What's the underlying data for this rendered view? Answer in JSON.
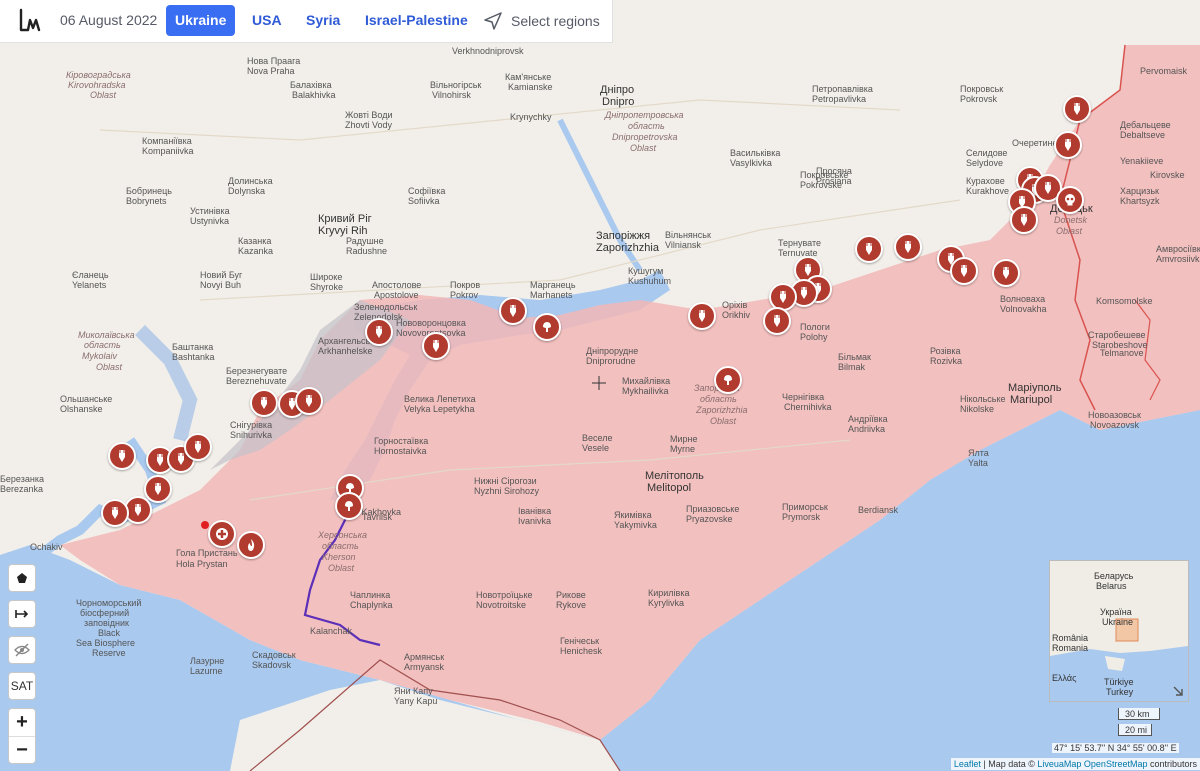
{
  "header": {
    "date": "06 August 2022",
    "tabs": [
      {
        "label": "Ukraine",
        "active": true
      },
      {
        "label": "USA",
        "active": false
      },
      {
        "label": "Syria",
        "active": false
      },
      {
        "label": "Israel-Palestine",
        "active": false
      }
    ],
    "select_regions": "Select regions"
  },
  "colors": {
    "occupied_fill": "#f2b7b7",
    "land": "#f2efea",
    "water": "#a9c9ef",
    "marker": "#b13b2e",
    "front_line": "#d9534f",
    "tab_active": "#3a6ef2",
    "route_line": "#5b2fb8"
  },
  "map": {
    "labels": [
      {
        "id": "verkhnodniprovsk",
        "text": "Verkhnodniprovsk"
      },
      {
        "id": "kirovohradska",
        "text": "Кіровоградська"
      },
      {
        "id": "kirovohradska_lat",
        "text": "Kirovohradska"
      },
      {
        "id": "kirovohradska_oblast",
        "text": "Oblast"
      },
      {
        "id": "nova_prarha",
        "text": "Нова Праага"
      },
      {
        "id": "nova_prarha_lat",
        "text": "Nova Praha"
      },
      {
        "id": "kamianske",
        "text": "Кам'янське"
      },
      {
        "id": "kamianske_lat",
        "text": "Kamianske"
      },
      {
        "id": "dnipro",
        "text": "Дніпро"
      },
      {
        "id": "dnipro_lat",
        "text": "Dnipro"
      },
      {
        "id": "dnipropetrovska",
        "text": "Дніпропетровська"
      },
      {
        "id": "dnipropetrovska2",
        "text": "область"
      },
      {
        "id": "dnipropetrovska3",
        "text": "Dnipropetrovska"
      },
      {
        "id": "dnipropetrovska4",
        "text": "Oblast"
      },
      {
        "id": "balakhivka",
        "text": "Балахівка"
      },
      {
        "id": "balakhivka_lat",
        "text": "Balakhivka"
      },
      {
        "id": "vilnohirsk",
        "text": "Вільногірськ"
      },
      {
        "id": "vilnohirsk_lat",
        "text": "Vilnohirsk"
      },
      {
        "id": "zhovti_vody",
        "text": "Жовті Води"
      },
      {
        "id": "zhovti_vody_lat",
        "text": "Zhovti Vody"
      },
      {
        "id": "kryvyi_rih",
        "text": "Кривий Ріг"
      },
      {
        "id": "kryvyi_rih_lat",
        "text": "Kryvyi Rih"
      },
      {
        "id": "zaporizhzhia",
        "text": "Запоріжжя"
      },
      {
        "id": "zaporizhzhia_lat",
        "text": "Zaporizhzhia"
      },
      {
        "id": "zaporizka",
        "text": "Запорізька"
      },
      {
        "id": "zaporizka2",
        "text": "область"
      },
      {
        "id": "zaporizka3",
        "text": "Zaporizhzhia"
      },
      {
        "id": "zaporizka4",
        "text": "Oblast"
      },
      {
        "id": "donetsk",
        "text": "Донецьк"
      },
      {
        "id": "donetsk_lat",
        "text": "Donetsk"
      },
      {
        "id": "donetska",
        "text": "Oblast"
      },
      {
        "id": "mariupol",
        "text": "Маріуполь"
      },
      {
        "id": "mariupol_lat",
        "text": "Mariupol"
      },
      {
        "id": "melitopol",
        "text": "Мелітополь"
      },
      {
        "id": "melitopol_lat",
        "text": "Melitopol"
      },
      {
        "id": "berdiansk",
        "text": "Berdiansk"
      },
      {
        "id": "kherson_obl",
        "text": "Херсонська"
      },
      {
        "id": "kherson_obl2",
        "text": "область"
      },
      {
        "id": "kherson_obl3",
        "text": "Kherson"
      },
      {
        "id": "kherson_obl4",
        "text": "Oblast"
      },
      {
        "id": "mykolaiv",
        "text": "Миколаївська"
      },
      {
        "id": "mykolaiv2",
        "text": "область"
      },
      {
        "id": "mykolaiv3",
        "text": "Mykolaiv"
      },
      {
        "id": "mykolaiv4",
        "text": "Oblast"
      },
      {
        "id": "nova_kakhovka",
        "text": "Nova Kakhovka"
      },
      {
        "id": "hola_prystan",
        "text": "Гола Пристань"
      },
      {
        "id": "hola_prystan_lat",
        "text": "Hola Prystan"
      },
      {
        "id": "skadovsk",
        "text": "Скадовськ"
      },
      {
        "id": "skadovsk_lat",
        "text": "Skadovsk"
      },
      {
        "id": "lazurne",
        "text": "Лазурне"
      },
      {
        "id": "lazurne_lat",
        "text": "Lazurne"
      },
      {
        "id": "kalanchak",
        "text": "Kalanchak"
      },
      {
        "id": "armyansk",
        "text": "Армянськ"
      },
      {
        "id": "armyansk_lat",
        "text": "Armyansk"
      },
      {
        "id": "yany_kapu",
        "text": "Яни Капу"
      },
      {
        "id": "yany_kapu_lat",
        "text": "Yany Kapu"
      },
      {
        "id": "chaplynka",
        "text": "Чаплинка"
      },
      {
        "id": "chaplynka_lat",
        "text": "Chaplynka"
      },
      {
        "id": "henichesk",
        "text": "Генічеськ"
      },
      {
        "id": "henichesk_lat",
        "text": "Henichesk"
      },
      {
        "id": "novotroitske",
        "text": "Новотроїцьке"
      },
      {
        "id": "novotroitske_lat",
        "text": "Novotroitske"
      },
      {
        "id": "rykove",
        "text": "Рикове"
      },
      {
        "id": "rykove_lat",
        "text": "Rykove"
      },
      {
        "id": "nyzhni_sirohozy",
        "text": "Нижні Сірогози"
      },
      {
        "id": "nyzhni_sirohozy_lat",
        "text": "Nyzhni Sirohozy"
      },
      {
        "id": "velyka_lepetykha",
        "text": "Велика Лепетиха"
      },
      {
        "id": "velyka_lepetykha_lat",
        "text": "Velyka Lepetykha"
      },
      {
        "id": "hornostaivka",
        "text": "Горностаївка"
      },
      {
        "id": "hornostaivka_lat",
        "text": "Hornostaivka"
      },
      {
        "id": "vesele",
        "text": "Веселе"
      },
      {
        "id": "vesele_lat",
        "text": "Vesele"
      },
      {
        "id": "myrne",
        "text": "Мирне"
      },
      {
        "id": "myrne_lat",
        "text": "Myrne"
      },
      {
        "id": "ivanivka",
        "text": "Іванівка"
      },
      {
        "id": "ivanivka_lat",
        "text": "Ivanivka"
      },
      {
        "id": "yakymivka",
        "text": "Якимівка"
      },
      {
        "id": "yakymivka_lat",
        "text": "Yakymivka"
      },
      {
        "id": "pryazovske",
        "text": "Приазовське"
      },
      {
        "id": "pryazovske_lat",
        "text": "Pryazovske"
      },
      {
        "id": "prymorsk",
        "text": "Приморськ"
      },
      {
        "id": "prymorsk_lat",
        "text": "Prymorsk"
      },
      {
        "id": "kyrylivka",
        "text": "Кирилівка"
      },
      {
        "id": "kyrylivka_lat",
        "text": "Kyrylivka"
      },
      {
        "id": "chernihivka",
        "text": "Чернігівка"
      },
      {
        "id": "chernihivka_lat",
        "text": "Chernihivka"
      },
      {
        "id": "bilmak",
        "text": "Більмак"
      },
      {
        "id": "bilmak_lat",
        "text": "Bilmak"
      },
      {
        "id": "polohy",
        "text": "Пологи"
      },
      {
        "id": "polohy_lat",
        "text": "Polohy"
      },
      {
        "id": "orikhiv",
        "text": "Оріхів"
      },
      {
        "id": "orikhiv_lat",
        "text": "Orikhiv"
      },
      {
        "id": "mykhailivka",
        "text": "Михайлівка"
      },
      {
        "id": "mykhailivka_lat",
        "text": "Mykhailivka"
      },
      {
        "id": "dniprorudne",
        "text": "Дніпрорудне"
      },
      {
        "id": "dniprorudne_lat",
        "text": "Dniprorudne"
      },
      {
        "id": "marhanets",
        "text": "Марганець"
      },
      {
        "id": "marhanets_lat",
        "text": "Marhanets"
      },
      {
        "id": "pokrov",
        "text": "Покров"
      },
      {
        "id": "pokrov_lat",
        "text": "Pokrov"
      },
      {
        "id": "apostolove",
        "text": "Апостолове"
      },
      {
        "id": "apostolove_lat",
        "text": "Apostolove"
      },
      {
        "id": "zelenodolsk",
        "text": "Зеленодольськ"
      },
      {
        "id": "zelenodolsk_lat",
        "text": "Zelenodolsk"
      },
      {
        "id": "novovorontsovka",
        "text": "Нововоронцовка"
      },
      {
        "id": "novovorontsovka_lat",
        "text": "Novovorontsovka"
      },
      {
        "id": "arkhanhelske",
        "text": "Архангельське"
      },
      {
        "id": "arkhanhelske_lat",
        "text": "Arkhanhelske"
      },
      {
        "id": "bereznehuvate",
        "text": "Березнегувате"
      },
      {
        "id": "bereznehuvate_lat",
        "text": "Bereznehuvate"
      },
      {
        "id": "snihurivka",
        "text": "Снігурівка"
      },
      {
        "id": "snihurivka_lat",
        "text": "Snihurivka"
      },
      {
        "id": "bashtanka",
        "text": "Баштанка"
      },
      {
        "id": "bashtanka_lat",
        "text": "Bashtanka"
      },
      {
        "id": "novyi_buh",
        "text": "Новий Буг"
      },
      {
        "id": "novyi_buh_lat",
        "text": "Novyi Buh"
      },
      {
        "id": "shyroke",
        "text": "Широке"
      },
      {
        "id": "shyroke_lat",
        "text": "Shyroke"
      },
      {
        "id": "olshanske",
        "text": "Ольшанське"
      },
      {
        "id": "olshanske_lat",
        "text": "Olshanske"
      },
      {
        "id": "ochakiv",
        "text": "Ochakiv"
      },
      {
        "id": "berezanka",
        "text": "Березанка"
      },
      {
        "id": "berezanka_lat",
        "text": "Berezanka"
      },
      {
        "id": "black_sea",
        "text": "Чорноморський"
      },
      {
        "id": "black_sea2",
        "text": "біосферний"
      },
      {
        "id": "black_sea3",
        "text": "заповідник"
      },
      {
        "id": "black_sea4",
        "text": "Black"
      },
      {
        "id": "black_sea5",
        "text": "Sea Biosphere"
      },
      {
        "id": "black_sea6",
        "text": "Reserve"
      },
      {
        "id": "pokrovske",
        "text": "Покровське"
      },
      {
        "id": "pokrovske_lat",
        "text": "Pokrovske"
      },
      {
        "id": "vilnianka",
        "text": "Вільнянськ"
      },
      {
        "id": "vilnianka_lat",
        "text": "Vilniansk"
      },
      {
        "id": "ternuvate",
        "text": "Тернувате"
      },
      {
        "id": "ternuvate_lat",
        "text": "Ternuvate"
      },
      {
        "id": "kurakhove",
        "text": "Курахове"
      },
      {
        "id": "kurakhove_lat",
        "text": "Kurakhove"
      },
      {
        "id": "selydove",
        "text": "Селидове"
      },
      {
        "id": "selydove_lat",
        "text": "Selydove"
      },
      {
        "id": "volnovakha",
        "text": "Волноваха"
      },
      {
        "id": "volnovakha_lat",
        "text": "Volnovakha"
      },
      {
        "id": "nikolske",
        "text": "Нікольське"
      },
      {
        "id": "nikolske_lat",
        "text": "Nikolske"
      },
      {
        "id": "rozivka",
        "text": "Розівка"
      },
      {
        "id": "rozivka_lat",
        "text": "Rozivka"
      },
      {
        "id": "andriivka",
        "text": "Андріївка"
      },
      {
        "id": "andriivka_lat",
        "text": "Andriivka"
      },
      {
        "id": "yalta",
        "text": "Ялта"
      },
      {
        "id": "yalta_lat",
        "text": "Yalta"
      },
      {
        "id": "novoazovsk",
        "text": "Новоазовськ"
      },
      {
        "id": "novoazovsk_lat",
        "text": "Novoazovsk"
      },
      {
        "id": "starobesheve",
        "text": "Старобешеве"
      },
      {
        "id": "debaltseve",
        "text": "Дебальцеве"
      },
      {
        "id": "debaltseve_lat",
        "text": "Debaltseve"
      },
      {
        "id": "khartsyzk",
        "text": "Харцизьк"
      },
      {
        "id": "khartsyzk_lat",
        "text": "Khartsyzk"
      },
      {
        "id": "amvrosiivka",
        "text": "Амвросіївка"
      },
      {
        "id": "amvrosiivka_lat",
        "text": "Amvrosiivka"
      },
      {
        "id": "petropavlivka",
        "text": "Петропавлівка"
      },
      {
        "id": "petropavlivka_lat",
        "text": "Petropavlivka"
      },
      {
        "id": "pokrovsk",
        "text": "Покровськ"
      },
      {
        "id": "pokrovsk_lat",
        "text": "Pokrovsk"
      },
      {
        "id": "kushuhum",
        "text": "Кушугум"
      },
      {
        "id": "kushuhum_lat",
        "text": "Kushuhum"
      },
      {
        "id": "staroshove",
        "text": "Starobeshove"
      },
      {
        "id": "vasylkivka",
        "text": "Васильківка"
      },
      {
        "id": "vasylkivka_lat",
        "text": "Vasylkivka"
      },
      {
        "id": "prosiana",
        "text": "Просяна"
      },
      {
        "id": "prosiana_lat",
        "text": "Prosiana"
      },
      {
        "id": "komsomolske",
        "text": "Komsomolske"
      },
      {
        "id": "telmanove",
        "text": "Telmanove"
      },
      {
        "id": "kirovske",
        "text": "Kirovske"
      },
      {
        "id": "yenakiieve",
        "text": "Yenakiieve"
      },
      {
        "id": "ocheretyne",
        "text": "Очеретине"
      },
      {
        "id": "pervomaisk",
        "text": "Pervomaisk"
      },
      {
        "id": "bobrynets",
        "text": "Бобринець"
      },
      {
        "id": "bobrynets_lat",
        "text": "Bobrynets"
      },
      {
        "id": "kompaniivka",
        "text": "Компаніївка"
      },
      {
        "id": "kompaniivka_lat",
        "text": "Kompaniivka"
      },
      {
        "id": "dolynska",
        "text": "Долинська"
      },
      {
        "id": "dolynska_lat",
        "text": "Dolynska"
      },
      {
        "id": "ustynivka",
        "text": "Устинівка"
      },
      {
        "id": "ustynivka_lat",
        "text": "Ustynivka"
      },
      {
        "id": "kazanka",
        "text": "Казанка"
      },
      {
        "id": "kazanka_lat",
        "text": "Kazanka"
      },
      {
        "id": "yelanets",
        "text": "Єланець"
      },
      {
        "id": "yelanets_lat",
        "text": "Yelanets"
      },
      {
        "id": "sofiivka",
        "text": "Софіївка"
      },
      {
        "id": "sofiivka_lat",
        "text": "Sofiivka"
      },
      {
        "id": "radushne",
        "text": "Радушне"
      },
      {
        "id": "radushne_lat",
        "text": "Radushne"
      },
      {
        "id": "krynychky",
        "text": "Krynychky"
      },
      {
        "id": "tavriisk",
        "text": "Tavriisk"
      }
    ],
    "markers_count": 42,
    "legend_minimap": {
      "belarus": "Беларусь",
      "belarus_lat": "Belarus",
      "ukraine": "Україна",
      "ukraine_lat": "Ukraine",
      "romania": "România",
      "romania_lat": "Romania",
      "turkey": "Türkiye",
      "turkey_lat": "Turkey",
      "greece": "Ελλάς"
    },
    "scale": {
      "km": "30 km",
      "mi": "20 mi"
    },
    "coordinates": "47° 15' 53.7'' N 34° 55' 00.8'' E",
    "attribution": {
      "leaflet": "Leaflet",
      "sep": " | Map data © ",
      "liveuamap": "LiveuaMap",
      "osm": "OpenStreetMap",
      "contrib": " contributors"
    }
  },
  "controls": {
    "polygon_icon": "pentagon-icon",
    "ruler_icon": "measure-icon",
    "hide_icon": "eye-slash-icon",
    "sat_label": "SAT",
    "zoom_in": "+",
    "zoom_out": "−"
  }
}
